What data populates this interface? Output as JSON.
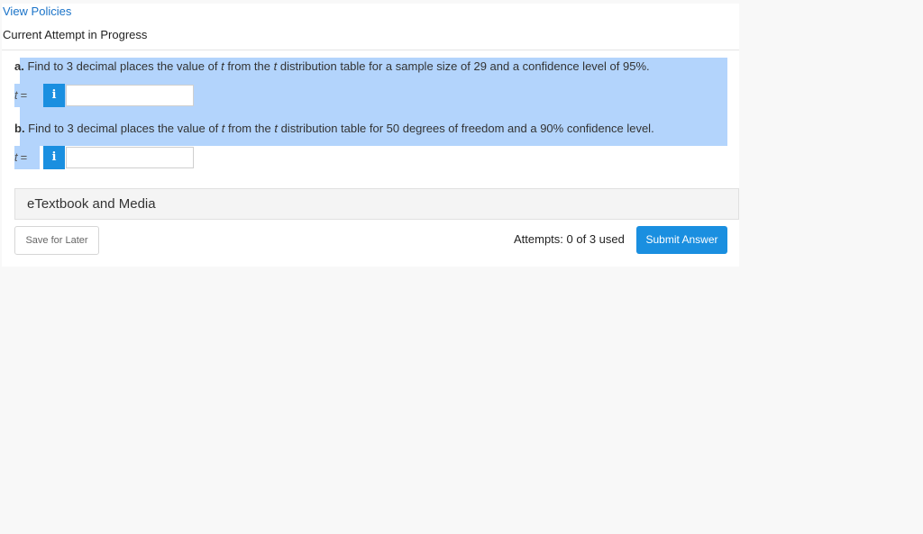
{
  "header": {
    "view_policies": "View Policies",
    "attempt_status": "Current Attempt in Progress"
  },
  "questions": [
    {
      "part": "a.",
      "text_pre": " Find to 3 decimal places the value of ",
      "var1": "t",
      "text_mid": " from the ",
      "var2": "t",
      "text_post": " distribution table for a sample size of 29 and a confidence level of 95%.",
      "answer_var": "t",
      "answer_eq": "=",
      "info_icon": "i",
      "answer_value": ""
    },
    {
      "part": "b.",
      "text_pre": " Find to 3 decimal places the value of ",
      "var1": "t",
      "text_mid": " from the ",
      "var2": "t",
      "text_post": " distribution table for 50 degrees of freedom and a 90% confidence level.",
      "answer_var": "t",
      "answer_eq": "=",
      "info_icon": "i",
      "answer_value": ""
    }
  ],
  "resources": {
    "etextbook_label": "eTextbook and Media"
  },
  "footer": {
    "save_label": "Save for Later",
    "attempts_text": "Attempts: 0 of 3 used",
    "submit_label": "Submit Answer"
  },
  "colors": {
    "accent": "#1a8fe0",
    "link": "#1a73c8",
    "highlight": "#b3d4fc"
  }
}
